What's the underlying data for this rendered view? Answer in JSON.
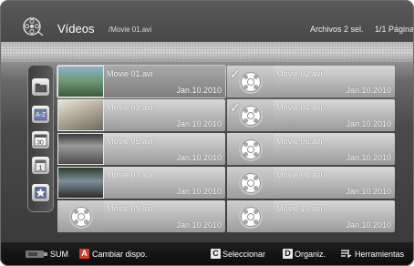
{
  "header": {
    "app_title": "Vídeos",
    "file_name": "/Movie 01.avi",
    "selection_count": "Archivos 2 sel.",
    "page_info": "1/1 Página",
    "icon": "film-folder-icon"
  },
  "rail": {
    "items": [
      {
        "name": "folder-view",
        "icon": "folder-icon"
      },
      {
        "name": "title-view",
        "icon": "alphabet-icon",
        "label": "A-Z"
      },
      {
        "name": "date-view",
        "icon": "calendar-icon",
        "label": "30"
      },
      {
        "name": "month-view",
        "icon": "month-icon",
        "label": "1"
      },
      {
        "name": "favorite-view",
        "icon": "star-icon"
      }
    ]
  },
  "items": [
    {
      "name": "Movie 01.avi",
      "date": "Jan.10.2010",
      "thumb": "photo-1",
      "focused": true,
      "selected": false
    },
    {
      "name": "Movie 02.avi",
      "date": "Jan.10.2010",
      "thumb": "film",
      "focused": false,
      "selected": true
    },
    {
      "name": "Movie 03.avi",
      "date": "Jan.10.2010",
      "thumb": "photo-2",
      "focused": false,
      "selected": false
    },
    {
      "name": "Movie 04.avi",
      "date": "Jan.10.2010",
      "thumb": "film",
      "focused": false,
      "selected": true
    },
    {
      "name": "Movie 05.avi",
      "date": "Jan.10.2010",
      "thumb": "photo-3",
      "focused": false,
      "selected": false
    },
    {
      "name": "Movie 06.avi",
      "date": "Jan.10.2010",
      "thumb": "film",
      "focused": false,
      "selected": false
    },
    {
      "name": "Movie 07.avi",
      "date": "Jan.10.2010",
      "thumb": "photo-4",
      "focused": false,
      "selected": false
    },
    {
      "name": "Movie 08.avi",
      "date": "Jan.10.2010",
      "thumb": "film",
      "focused": false,
      "selected": false
    },
    {
      "name": "Movie 09.avi",
      "date": "Jan.10.2010",
      "thumb": "film",
      "focused": false,
      "selected": false
    },
    {
      "name": "Movie 10.avi",
      "date": "Jan.10.2010",
      "thumb": "film",
      "focused": false,
      "selected": false
    }
  ],
  "footer": {
    "sum_label": "SUM",
    "a_key": "A",
    "a_label": "Cambiar dispo.",
    "c_key": "C",
    "c_label": "Seleccionar",
    "d_key": "D",
    "d_label": "Organiz.",
    "tools_label": "Herramientas"
  },
  "colors": {
    "key_a": "#d23b2e",
    "key_c": "#e8e8e8",
    "key_d": "#e8e8e8"
  }
}
